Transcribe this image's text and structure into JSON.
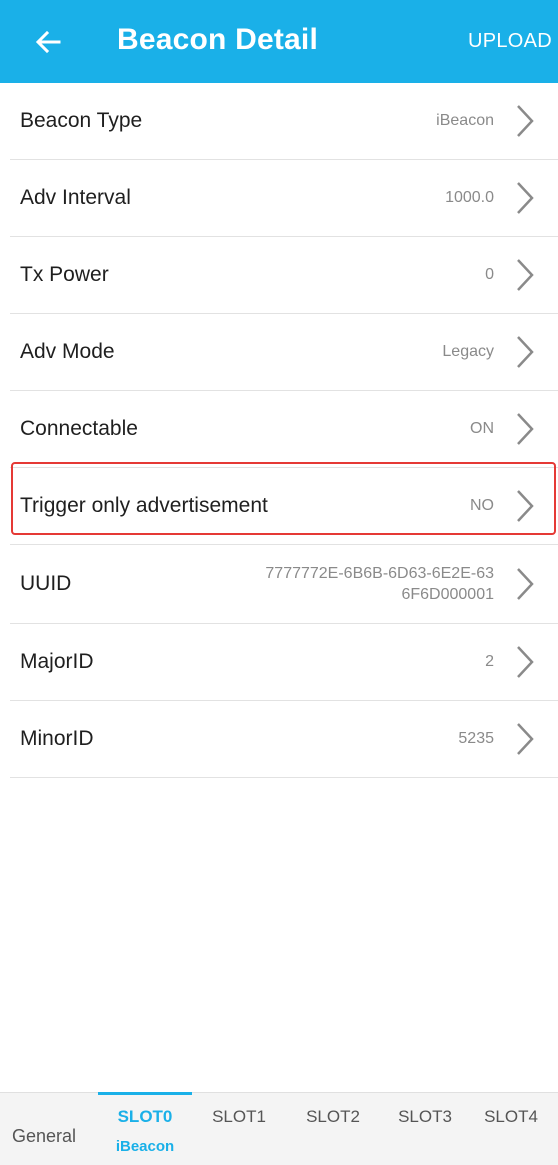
{
  "header": {
    "title": "Beacon Detail",
    "upload_label": "UPLOAD",
    "back_icon": "arrow-left-icon"
  },
  "rows": [
    {
      "label": "Beacon Type",
      "value": "iBeacon"
    },
    {
      "label": "Adv Interval",
      "value": "1000.0"
    },
    {
      "label": "Tx Power",
      "value": "0"
    },
    {
      "label": "Adv Mode",
      "value": "Legacy"
    },
    {
      "label": "Connectable",
      "value": "ON"
    },
    {
      "label": "Trigger only advertisement",
      "value": "NO"
    },
    {
      "label": "UUID",
      "value_line1": "7777772E-6B6B-6D63-6E2E-63",
      "value_line2": "6F6D000001"
    },
    {
      "label": "MajorID",
      "value": "2"
    },
    {
      "label": "MinorID",
      "value": "5235"
    }
  ],
  "tabs": {
    "general": "General",
    "slots": [
      {
        "label": "SLOT0",
        "sub": "iBeacon"
      },
      {
        "label": "SLOT1",
        "sub": ""
      },
      {
        "label": "SLOT2",
        "sub": ""
      },
      {
        "label": "SLOT3",
        "sub": ""
      },
      {
        "label": "SLOT4",
        "sub": ""
      }
    ]
  },
  "colors": {
    "accent": "#1ab0e8",
    "highlight": "#e53935"
  }
}
